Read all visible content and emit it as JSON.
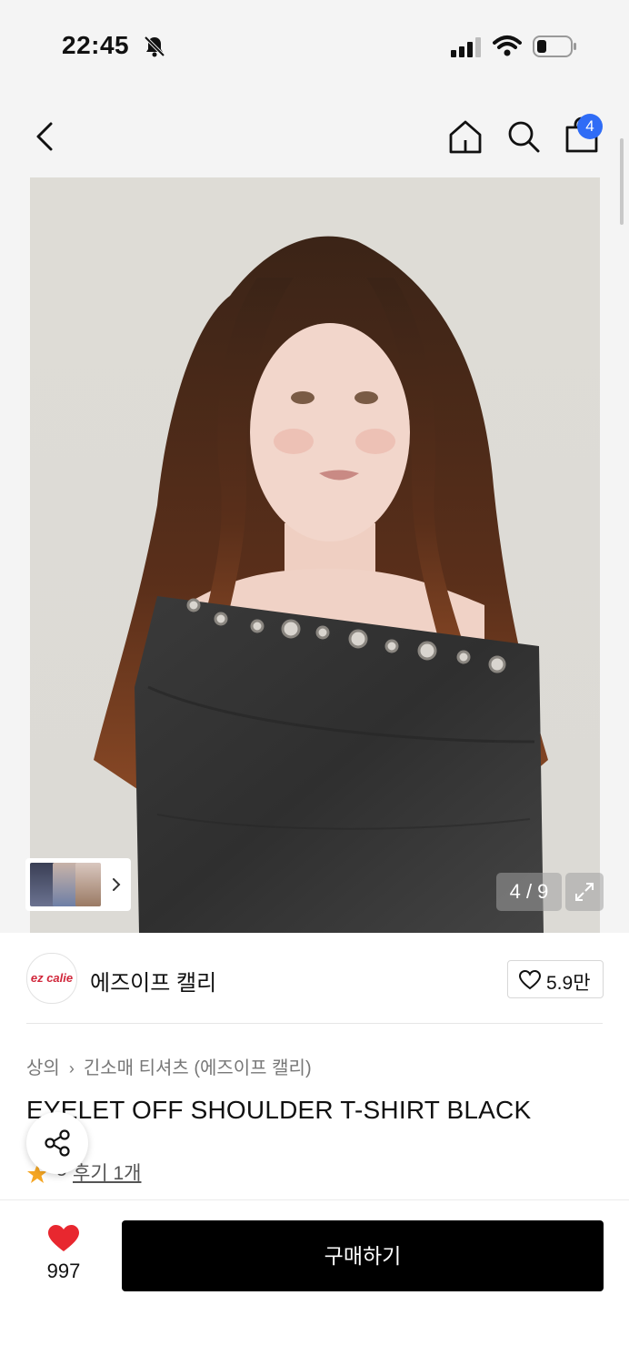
{
  "status_bar": {
    "time": "22:45"
  },
  "header": {
    "cart_count": "4"
  },
  "gallery": {
    "counter": "4 / 9",
    "current": 4,
    "total": 9
  },
  "brand": {
    "logo_text": "ez calie",
    "name": "에즈이프 캘리",
    "likes": "5.9만"
  },
  "product": {
    "breadcrumb": [
      "상의",
      "긴소매 티셔츠 (에즈이프 캘리)"
    ],
    "title": "EYELET OFF SHOULDER T-SHIRT BLACK",
    "rating_count": "5",
    "review_link": "후기 1개"
  },
  "bottom_bar": {
    "wish_count": "997",
    "buy_label": "구매하기"
  },
  "colors": {
    "accent_badge": "#2f6cf6",
    "heart_red": "#e8272f",
    "star_orange": "#f5a623",
    "buy_button": "#000000"
  }
}
